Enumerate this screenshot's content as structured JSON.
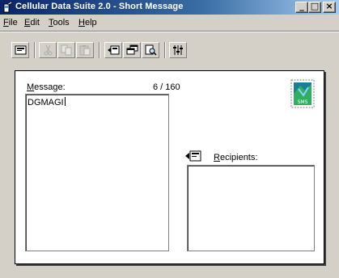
{
  "window": {
    "title": "Cellular Data Suite 2.0 - Short Message",
    "controls": {
      "minimize": "_",
      "maximize": "□",
      "close": "×"
    }
  },
  "menu": {
    "items": [
      {
        "key": "F",
        "rest": "ile"
      },
      {
        "key": "E",
        "rest": "dit"
      },
      {
        "key": "T",
        "rest": "ools"
      },
      {
        "key": "H",
        "rest": "elp"
      }
    ]
  },
  "toolbar": {
    "buttons": [
      {
        "icon": "new-message-icon",
        "enabled": true
      },
      {
        "icon": "cut-icon",
        "enabled": false
      },
      {
        "icon": "copy-icon",
        "enabled": false
      },
      {
        "icon": "paste-icon",
        "enabled": false
      },
      {
        "icon": "send-icon",
        "enabled": true
      },
      {
        "icon": "windows-icon",
        "enabled": true
      },
      {
        "icon": "preview-icon",
        "enabled": true
      },
      {
        "icon": "settings-icon",
        "enabled": true
      }
    ]
  },
  "message": {
    "label_key": "M",
    "label_rest": "essage:",
    "count": "6 / 160",
    "text": "DGMAGI"
  },
  "recipients": {
    "label_key": "R",
    "label_rest": "ecipients:"
  },
  "badge": {
    "text": "SMS"
  },
  "colors": {
    "face": "#d4d0c8",
    "title_start": "#0a246a",
    "title_end": "#a6caf0"
  }
}
